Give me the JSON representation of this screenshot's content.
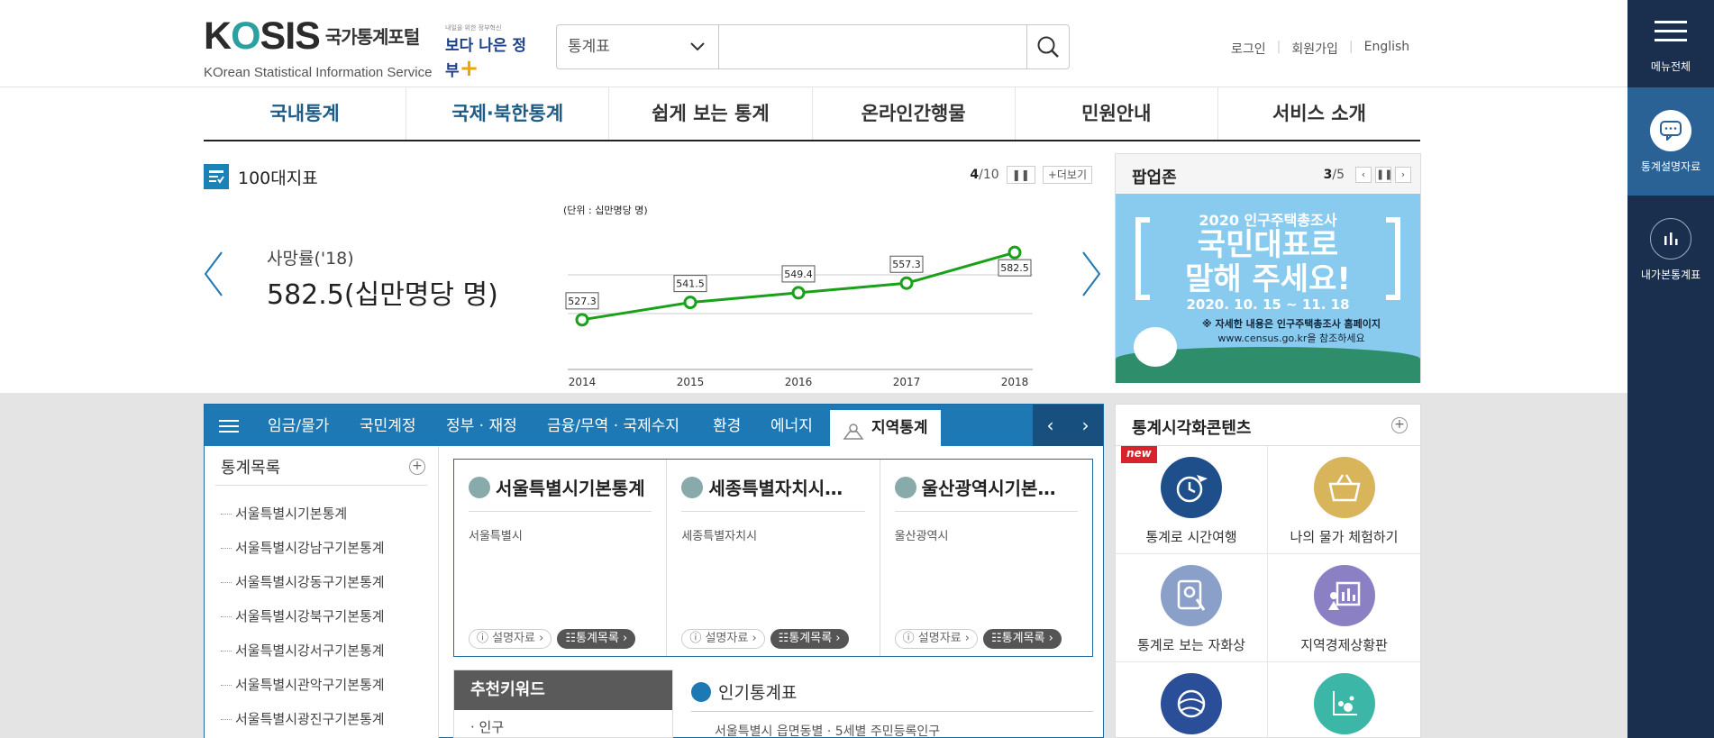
{
  "header": {
    "logo": {
      "main": "KOSIS",
      "ko": "국가통계포털",
      "sub": "KOrean Statistical Information Service"
    },
    "gov_badge": {
      "small": "내일을 위한 정부혁신",
      "main": "보다 나은 정부"
    },
    "search": {
      "category": "통계표",
      "placeholder": ""
    },
    "util_links": [
      "로그인",
      "회원가입",
      "English"
    ]
  },
  "right_sidebar": {
    "menu_label": "메뉴전체",
    "items": [
      {
        "label": "통계설명자료",
        "icon": "chat-icon"
      },
      {
        "label": "내가본통계표",
        "icon": "bar-chart-icon"
      }
    ]
  },
  "nav": [
    "국내통계",
    "국제·북한통계",
    "쉽게 보는 통계",
    "온라인간행물",
    "민원안내",
    "서비스 소개"
  ],
  "indicators": {
    "title": "100대지표",
    "page_current": "4",
    "page_total": "/10",
    "more": "+더보기",
    "label": "사망률('18)",
    "value": "582.5(십만명당 명)"
  },
  "chart_data": {
    "type": "line",
    "title": "",
    "unit": "(단위 : 십만명당 명)",
    "x": [
      "2014",
      "2015",
      "2016",
      "2017",
      "2018"
    ],
    "series": [
      {
        "values": [
          527.3,
          541.5,
          549.4,
          557.3,
          582.5
        ]
      }
    ],
    "data_labels": [
      "527.3",
      "541.5",
      "549.4",
      "557.3",
      "582.5"
    ],
    "color": "#1aa01a",
    "grid": true
  },
  "popup": {
    "title": "팝업존",
    "page_current": "3",
    "page_total": "/5",
    "banner": {
      "line1": "2020 인구주택총조사",
      "line2": "국민대표로",
      "line3": "말해 주세요!",
      "line4": "2020. 10. 15 ~ 11. 18",
      "line5": "※ 자세한 내용은 인구주택총조사 홈페이지",
      "line6": "www.census.go.kr을 참조하세요"
    }
  },
  "categories": {
    "tabs": [
      "임금/물가",
      "국민계정",
      "정부 · 재정",
      "금융/무역 · 국제수지",
      "환경",
      "에너지"
    ],
    "active_tab": "지역통계",
    "tree_title": "통계목록",
    "tree": [
      "서울특별시기본통계",
      "서울특별시강남구기본통계",
      "서울특별시강동구기본통계",
      "서울특별시강북구기본통계",
      "서울특별시강서구기본통계",
      "서울특별시관악구기본통계",
      "서울특별시광진구기본통계"
    ],
    "region_cards": [
      {
        "title": "서울특별시기본통계",
        "sub": "서울특별시",
        "btn_desc": "설명자료",
        "btn_list": "통계목록"
      },
      {
        "title": "세종특별자치시…",
        "sub": "세종특별자치시",
        "btn_desc": "설명자료",
        "btn_list": "통계목록"
      },
      {
        "title": "울산광역시기본…",
        "sub": "울산광역시",
        "btn_desc": "설명자료",
        "btn_list": "통계목록"
      }
    ],
    "keyword_title": "추천키워드",
    "keyword_first": "· 인구",
    "popular_title": "인기통계표",
    "popular_first": "서울특별시 읍면동별 · 5세별 주민등록인구"
  },
  "viz": {
    "title": "통계시각화콘텐츠",
    "new_badge": "new",
    "items": [
      {
        "label": "통계로 시간여행",
        "color": "#1f4f8a",
        "icon": "clock-plane-icon"
      },
      {
        "label": "나의 물가 체험하기",
        "color": "#d8b55a",
        "icon": "basket-icon"
      },
      {
        "label": "통계로 보는 자화상",
        "color": "#8aa0c8",
        "icon": "portrait-icon"
      },
      {
        "label": "지역경제상황판",
        "color": "#8c80c4",
        "icon": "dashboard-icon"
      },
      {
        "label": "",
        "color": "#2a4f98",
        "icon": "globe-icon"
      },
      {
        "label": "",
        "color": "#3cb6a6",
        "icon": "scatter-icon"
      }
    ]
  }
}
